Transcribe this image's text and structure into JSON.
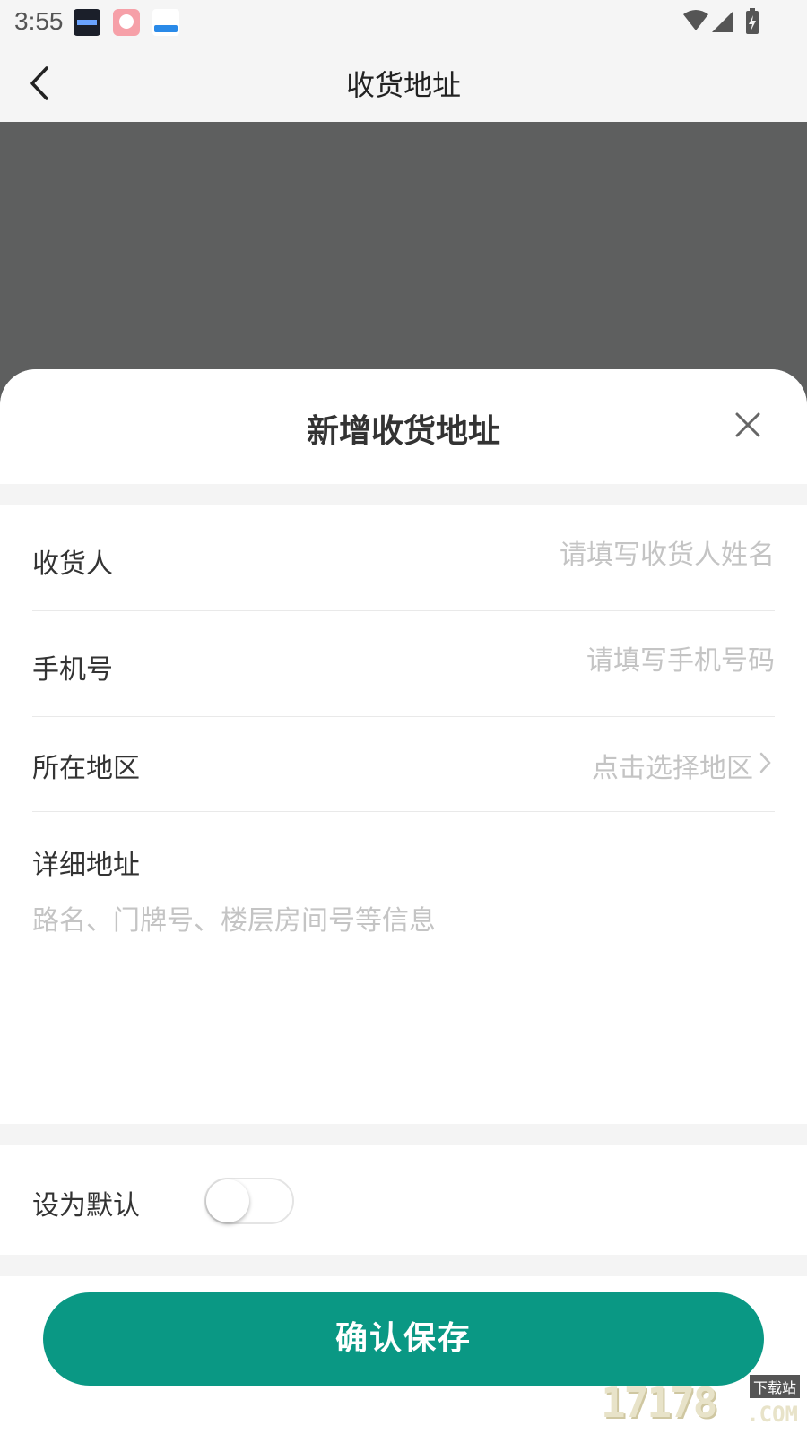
{
  "status_bar": {
    "time": "3:55",
    "notification_icons": [
      "clock-widget-app-icon",
      "pink-app-icon",
      "blue-app-icon"
    ],
    "system_icons": [
      "wifi-icon",
      "cellular-signal-icon",
      "battery-charging-icon"
    ]
  },
  "header": {
    "title": "收货地址",
    "back_icon": "chevron-left-icon"
  },
  "sheet": {
    "title": "新增收货地址",
    "close_icon": "close-icon",
    "fields": {
      "receiver": {
        "label": "收货人",
        "placeholder": "请填写收货人姓名",
        "value": ""
      },
      "phone": {
        "label": "手机号",
        "placeholder": "请填写手机号码",
        "value": ""
      },
      "region": {
        "label": "所在地区",
        "value": "点击选择地区"
      },
      "detail": {
        "label": "详细地址",
        "placeholder": "路名、门牌号、楼层房间号等信息",
        "value": ""
      }
    },
    "default_toggle": {
      "label": "设为默认",
      "on": false
    },
    "save_label": "确认保存"
  },
  "watermark": {
    "text": "17178",
    "tag": "下载站",
    "suffix": ".COM"
  },
  "colors": {
    "accent": "#0a9884",
    "backdrop": "#5e5f5f",
    "placeholder": "#c4c4c4",
    "text": "#333333"
  }
}
